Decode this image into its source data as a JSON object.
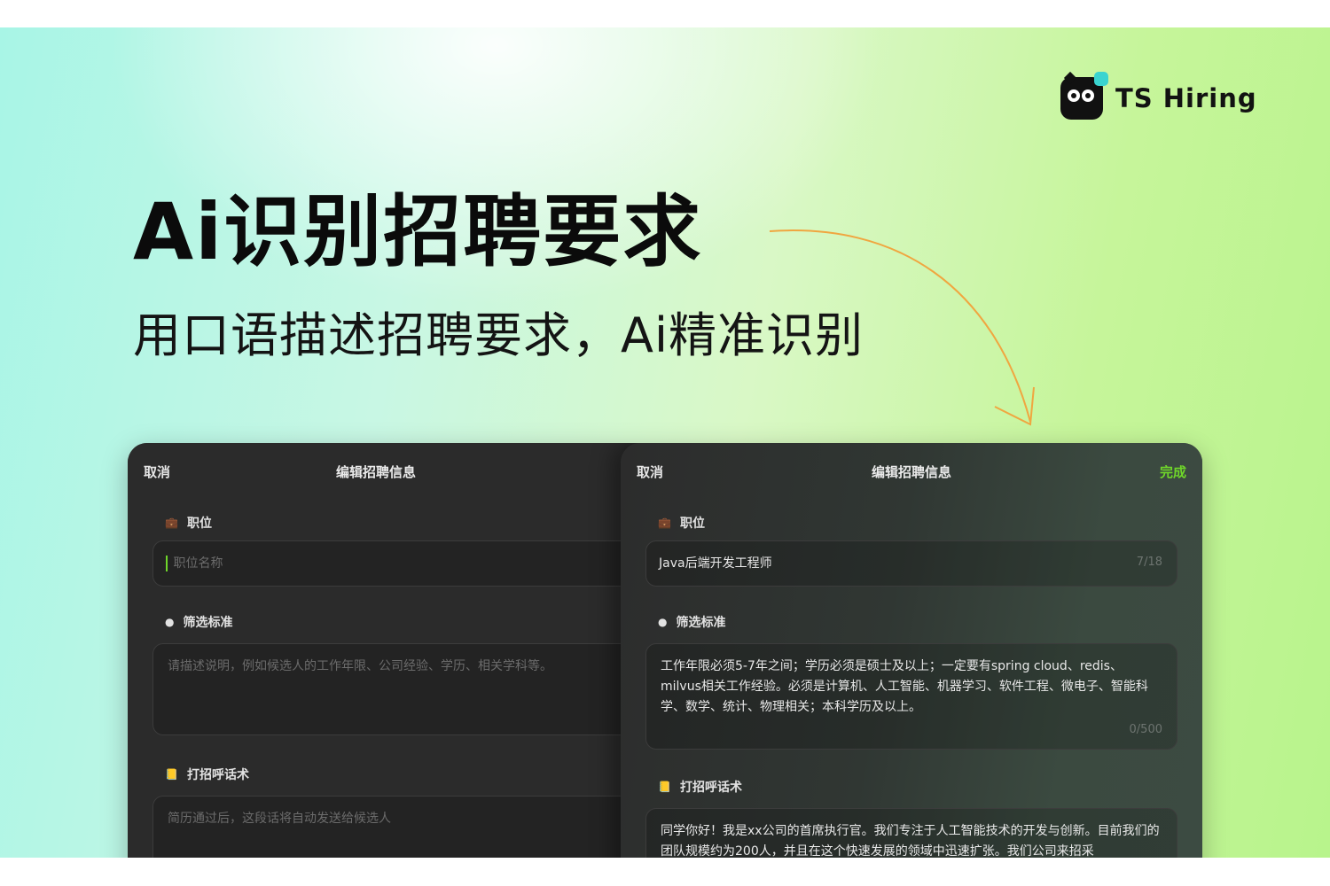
{
  "brand": {
    "name": "TS Hiring",
    "logo_icon": "owl-mascot-icon",
    "accent": "#3ad4d0"
  },
  "hero": {
    "headline": "Ai识别招聘要求",
    "subline": "用口语描述招聘要求，Ai精准识别"
  },
  "colors": {
    "accent_green": "#6fd62a",
    "panel_dark": "#2b2b2b"
  },
  "left_panel": {
    "cancel": "取消",
    "title": "编辑招聘信息",
    "position_label": "职位",
    "position_icon": "briefcase-icon",
    "position_placeholder": "职位名称",
    "criteria_label": "筛选标准",
    "criteria_icon": "dot-icon",
    "criteria_placeholder": "请描述说明，例如候选人的工作年限、公司经验、学历、相关学科等。",
    "greeting_label": "打招呼话术",
    "greeting_icon": "note-icon",
    "greeting_placeholder": "简历通过后，这段话将自动发送给候选人"
  },
  "right_panel": {
    "cancel": "取消",
    "title": "编辑招聘信息",
    "done": "完成",
    "position_label": "职位",
    "position_value": "Java后端开发工程师",
    "position_counter": "7/18",
    "criteria_label": "筛选标准",
    "criteria_value": "工作年限必须5-7年之间；学历必须是硕士及以上；一定要有spring cloud、redis、milvus相关工作经验。必须是计算机、人工智能、机器学习、软件工程、微电子、智能科学、数学、统计、物理相关；本科学历及以上。",
    "criteria_counter": "0/500",
    "greeting_label": "打招呼话术",
    "greeting_value": "同学你好！我是xx公司的首席执行官。我们专注于人工智能技术的开发与创新。目前我们的团队规模约为200人，并且在这个快速发展的领域中迅速扩张。我们公司来招采"
  }
}
